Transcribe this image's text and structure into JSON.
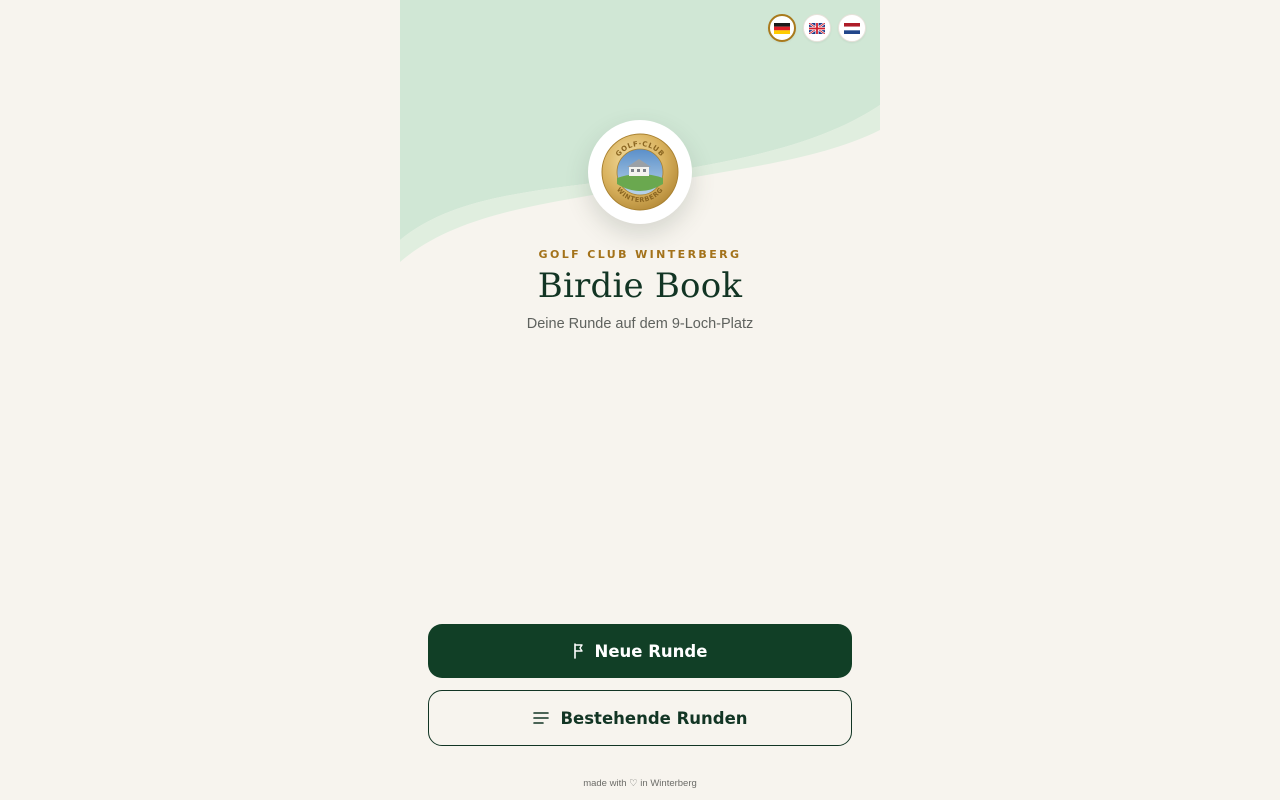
{
  "language_switcher": {
    "options": [
      {
        "code": "de",
        "icon": "germany-flag-icon",
        "active": true
      },
      {
        "code": "en",
        "icon": "uk-flag-icon",
        "active": false
      },
      {
        "code": "nl",
        "icon": "netherlands-flag-icon",
        "active": false
      }
    ]
  },
  "logo": {
    "icon": "golf-club-winterberg-logo",
    "text_top": "GOLF·CLUB",
    "text_bottom": "WINTERBERG"
  },
  "header": {
    "club_name": "GOLF CLUB WINTERBERG",
    "title": "Birdie Book",
    "subtitle": "Deine Runde auf dem 9-Loch-Platz"
  },
  "actions": {
    "new_round_label": "Neue Runde",
    "new_round_icon": "flag-icon",
    "existing_rounds_label": "Bestehende Runden",
    "existing_rounds_icon": "list-icon"
  },
  "footer": {
    "text": "made with ♡ in Winterberg"
  },
  "colors": {
    "background": "#f7f4ee",
    "hero_green": "#d0e7d5",
    "primary": "#113f26",
    "accent_gold": "#a3721a"
  }
}
